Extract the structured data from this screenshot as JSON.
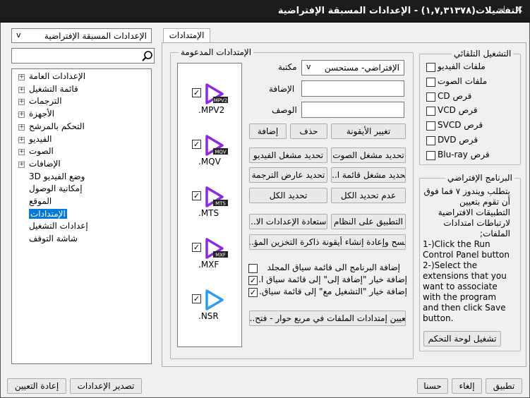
{
  "window": {
    "title": "التفضيلات(١,٧,٣١٣٧٨) - الإعدادات المسبقة الإفتراضية"
  },
  "sidebar": {
    "preset_value": "الإعدادات المسبقة الإفتراضية",
    "search_placeholder": "",
    "tree": [
      {
        "label": "الإعدادات العامة",
        "expandable": true,
        "level": 0
      },
      {
        "label": "قائمة التشغيل",
        "expandable": true,
        "level": 0
      },
      {
        "label": "الترجمات",
        "expandable": true,
        "level": 0
      },
      {
        "label": "الأجهزة",
        "expandable": true,
        "level": 0
      },
      {
        "label": "التحكم بالمرشح",
        "expandable": true,
        "level": 0
      },
      {
        "label": "الفيديو",
        "expandable": true,
        "level": 0
      },
      {
        "label": "الصوت",
        "expandable": true,
        "level": 0
      },
      {
        "label": "الإضافات",
        "expandable": true,
        "level": 0
      },
      {
        "label": "وضع الفيديو 3D",
        "expandable": false,
        "level": 1
      },
      {
        "label": "إمكانية الوصول",
        "expandable": false,
        "level": 1
      },
      {
        "label": "الموقع",
        "expandable": false,
        "level": 1
      },
      {
        "label": "الإمتدادات",
        "expandable": false,
        "level": 1,
        "selected": true
      },
      {
        "label": "إعدادات التشغيل",
        "expandable": false,
        "level": 1
      },
      {
        "label": "شاشة التوقف",
        "expandable": false,
        "level": 1
      }
    ]
  },
  "tab": {
    "label": "الإمتدادات"
  },
  "supported": {
    "group_label": "الإمتدادات المدعومة",
    "extensions": [
      {
        "name": ".MPV2",
        "badge": "MPV2",
        "checked": true,
        "color": "#8a2be2"
      },
      {
        "name": ".MQV",
        "badge": "MQV",
        "checked": true,
        "color": "#8a2be2"
      },
      {
        "name": ".MTS",
        "badge": "MTS",
        "checked": true,
        "color": "#8a2be2"
      },
      {
        "name": ".MXF",
        "badge": "MXF",
        "checked": true,
        "color": "#8a2be2"
      },
      {
        "name": ".NSR",
        "badge": "",
        "checked": true,
        "color": "#2e9bf0"
      }
    ],
    "library_label": "مكتبة",
    "library_value": "الإفتراضي- مستحسن",
    "addition_label": "الإضافة",
    "description_label": "الوصف",
    "btn_change_icon": "تغيير الأيقونة",
    "btn_delete": "حذف",
    "btn_add": "إضافة",
    "btn_select_audio_player": "تحديد مشغل الصوت",
    "btn_select_video_player": "تحديد مشغل الفيديو",
    "btn_select_playlist_player": "تحديد مشغل قائمة ا...",
    "btn_select_subtitle_viewer": "تحديد عارض الترجمة",
    "btn_deselect_all": "عدم تحديد الكل",
    "btn_select_all": "تحديد الكل",
    "btn_apply_system": "التطبيق على النظام",
    "btn_restore_settings": "إستعادة الإعدادات الا...",
    "btn_clear_rebuild_icon": "مسح وإعادة إنشاء أيقونة ذاكرة التخزين المؤ...",
    "chk_folder_menu": "إضافة البرنامج الى قائمة سياق المجلد",
    "chk_add_to": "إضافة خيار \"إضافة إلى\" إلى قائمة سياق ا...",
    "chk_play_with": "إضافة خيار \"التشغيل مع\" إلى قائمة سياق...",
    "chk_folder_menu_checked": false,
    "chk_add_to_checked": true,
    "chk_play_with_checked": true,
    "btn_assign_dialog": "تعيين إمتدادات الملفات في مربع حوار - فتح..."
  },
  "autoplay": {
    "group_label": "التشغيل التلقائي",
    "items": [
      {
        "label": "ملفات الفيديو",
        "checked": false
      },
      {
        "label": "ملفات الصوت",
        "checked": false
      },
      {
        "label": "قرص CD",
        "checked": false
      },
      {
        "label": "قرص VCD",
        "checked": false
      },
      {
        "label": "قرص SVCD",
        "checked": false
      },
      {
        "label": "قرص DVD",
        "checked": false
      },
      {
        "label": "قرص Blu-ray",
        "checked": false
      }
    ]
  },
  "default_program": {
    "group_label": "البرنامج الإفتراضي",
    "text_ar": "يتطلب ويندوز ٧ فما فوق أن تقوم بتعيين التطبيقات الافتراضية لارتباطات امتدادات الملفات;",
    "text_en": "1-)Click the Run Control Panel button 2-)Select the extensions that you want to associate with the program and then click Save button.",
    "btn_run_control_panel": "تشغيل لوحة التحكم"
  },
  "footer": {
    "btn_reset": "إعادة التعيين",
    "btn_export": "تصدير الإعدادات",
    "btn_ok": "حسنا",
    "btn_cancel": "إلغاء",
    "btn_apply": "تطبيق"
  }
}
